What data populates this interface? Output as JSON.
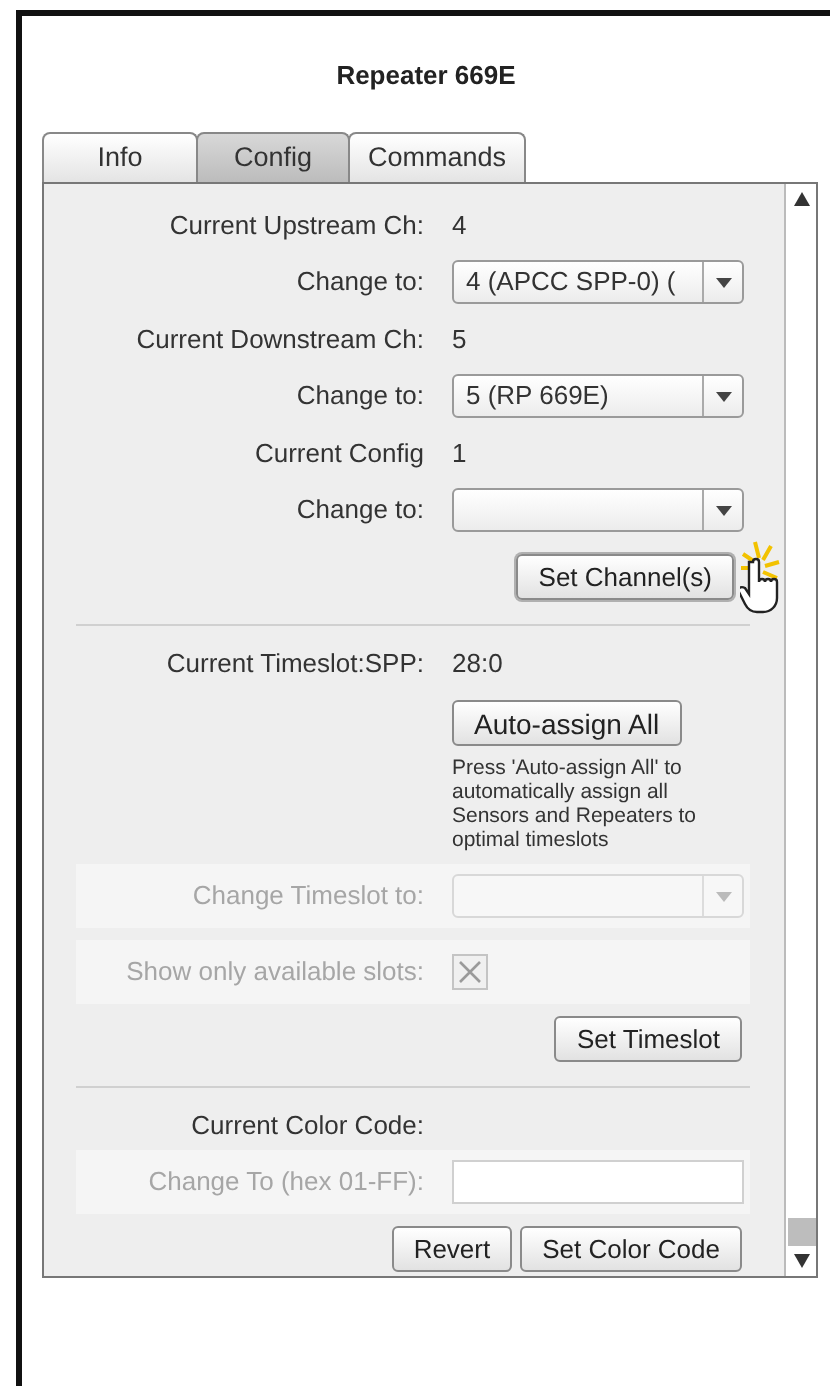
{
  "window": {
    "title": "Repeater 669E"
  },
  "tabs": [
    {
      "label": "Info",
      "selected": false
    },
    {
      "label": "Config",
      "selected": true
    },
    {
      "label": "Commands",
      "selected": false
    }
  ],
  "sections": [
    {
      "rows": [
        {
          "kind": "value",
          "label": "Current Upstream Ch:",
          "value": "4"
        },
        {
          "kind": "dropdown",
          "label": "Change to:",
          "value": "4 (APCC SPP-0) (",
          "disabled": false
        },
        {
          "kind": "value",
          "label": "Current Downstream Ch:",
          "value": "5"
        },
        {
          "kind": "dropdown",
          "label": "Change to:",
          "value": "5 (RP 669E)",
          "disabled": false
        },
        {
          "kind": "value",
          "label": "Current Config",
          "value": "1"
        },
        {
          "kind": "dropdown",
          "label": "Change to:",
          "disabled": false
        }
      ],
      "buttons": [
        {
          "label": "Set Channel(s)",
          "hovered": true
        }
      ]
    },
    {
      "rows": [
        {
          "kind": "value",
          "label": "Current Timeslot:SPP:",
          "value": "28:0"
        },
        {
          "kind": "action",
          "button": "Auto-assign All",
          "note": "Press 'Auto-assign All' to automatically assign all Sensors and Repeaters to optimal timeslots"
        },
        {
          "kind": "dropdown",
          "label": "Change Timeslot to:",
          "disabled": true
        },
        {
          "kind": "checkbox",
          "label": "Show only available slots:",
          "checked": true,
          "disabled": true
        }
      ],
      "buttons": [
        {
          "label": "Set Timeslot",
          "hovered": false
        }
      ]
    },
    {
      "rows": [
        {
          "kind": "value",
          "label": "Current Color Code:"
        },
        {
          "kind": "text_field",
          "label": "Change To (hex 01-FF):",
          "disabled": true
        }
      ],
      "buttons": [
        {
          "label": "Revert",
          "hovered": false
        },
        {
          "label": "Set Color Code",
          "hovered": false
        }
      ]
    }
  ]
}
